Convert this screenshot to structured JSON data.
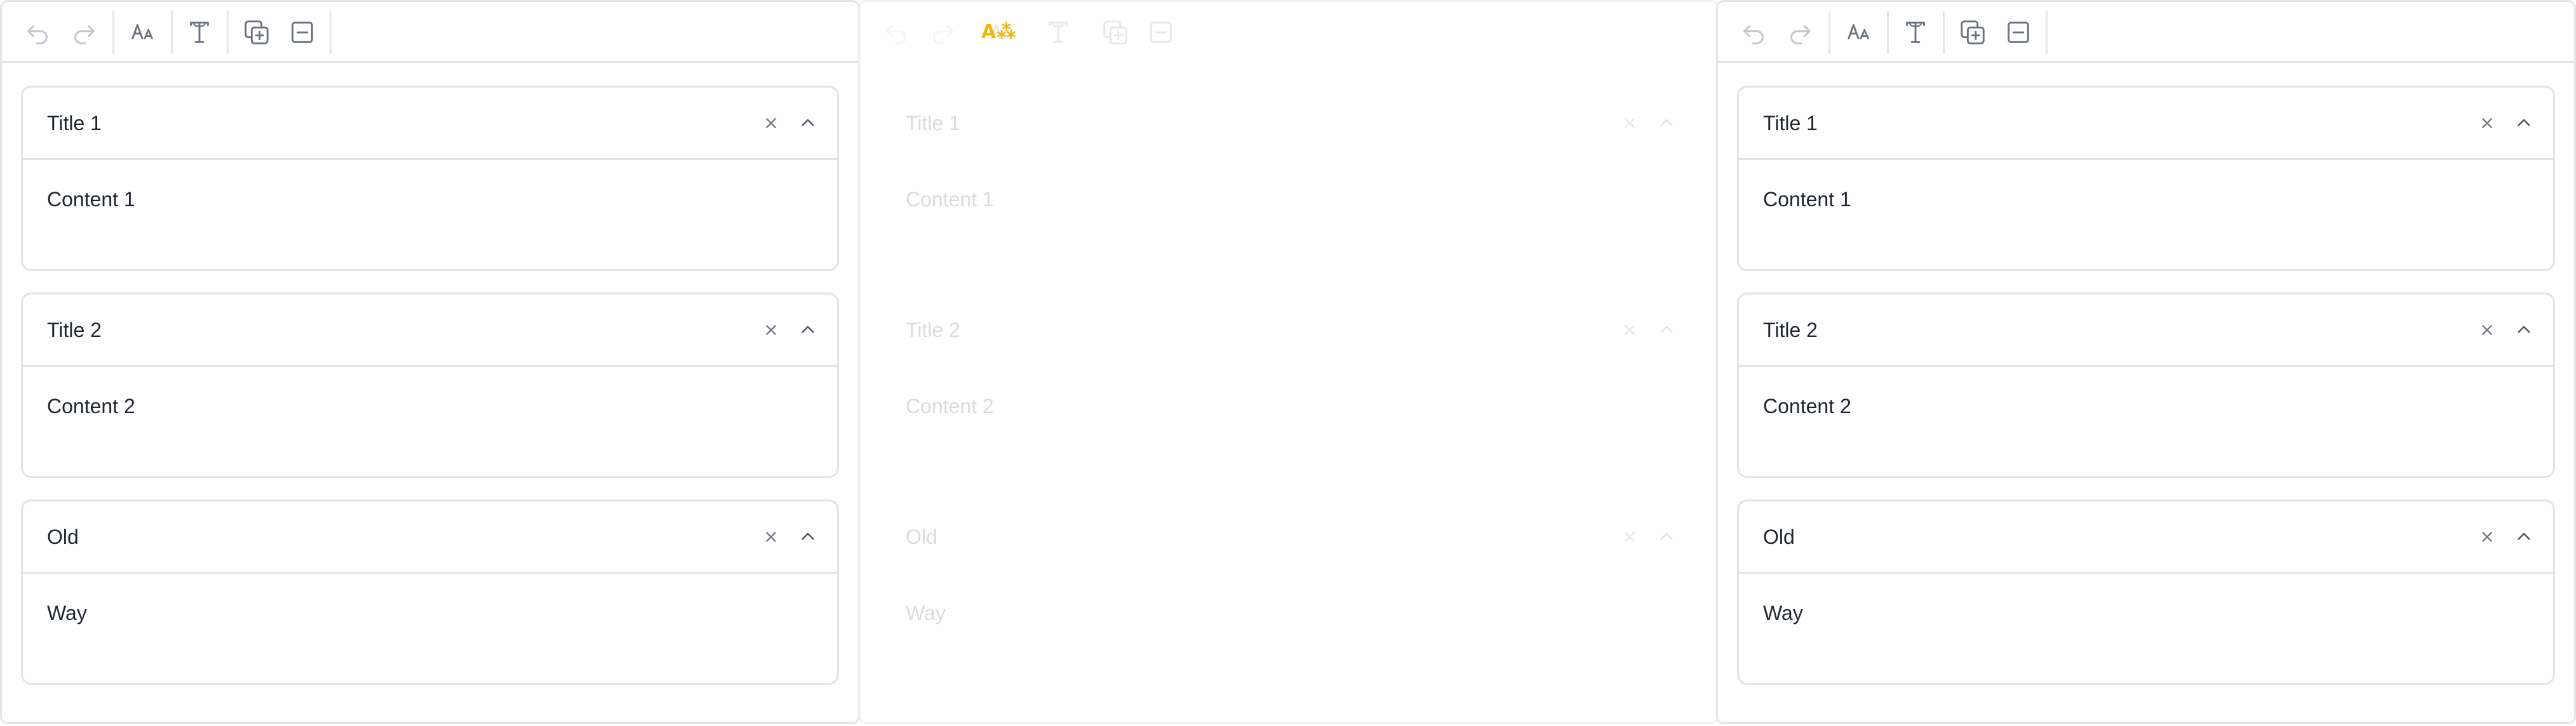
{
  "colors": {
    "border": "#e4e6ea",
    "text": "#1f2430",
    "icon": "#6b7280",
    "accent": "#f2b705"
  },
  "toolbar": {
    "icons": [
      "undo-icon",
      "redo-icon",
      "font-size-icon",
      "text-format-icon",
      "add-copy-icon",
      "remove-icon"
    ],
    "loading_glyph": "A⁂"
  },
  "panels": [
    {
      "id": "left",
      "items": [
        {
          "title": "Title 1",
          "content": "Content 1"
        },
        {
          "title": "Title 2",
          "content": "Content 2"
        },
        {
          "title": "Old",
          "content": "Way"
        }
      ]
    },
    {
      "id": "middle",
      "state": "loading",
      "items": [
        {
          "title": "Title 1",
          "content": "Content 1"
        },
        {
          "title": "Title 2",
          "content": "Content 2"
        },
        {
          "title": "Old",
          "content": "Way"
        }
      ]
    },
    {
      "id": "right",
      "items": [
        {
          "title": "Title 1",
          "content": "Content 1"
        },
        {
          "title": "Title 2",
          "content": "Content 2"
        },
        {
          "title": "Old",
          "content": "Way"
        }
      ]
    }
  ]
}
